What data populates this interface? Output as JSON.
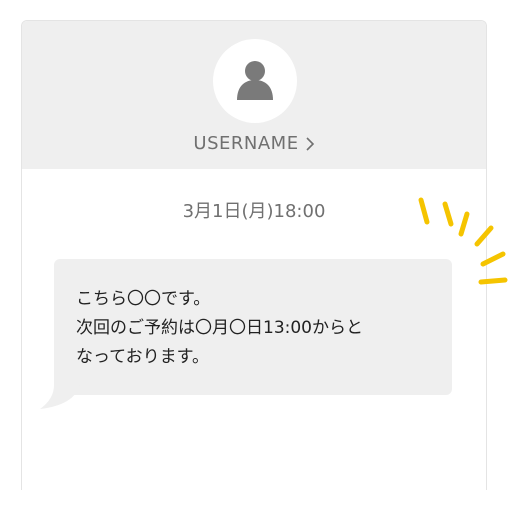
{
  "header": {
    "username": "USERNAME"
  },
  "chat": {
    "timestamp": "3月1日(月)18:00",
    "message": "こちら〇〇です。\n次回のご予約は〇月〇日13:00からと\nなっております。"
  },
  "colors": {
    "header_bg": "#efefef",
    "bubble_bg": "#efefef",
    "avatar_icon": "#7a7a7a",
    "accent": "#f5c400"
  },
  "icons": {
    "avatar": "user-silhouette-icon",
    "chevron": "chevron-right-icon",
    "sparkle": "sparkle-lines-icon"
  }
}
